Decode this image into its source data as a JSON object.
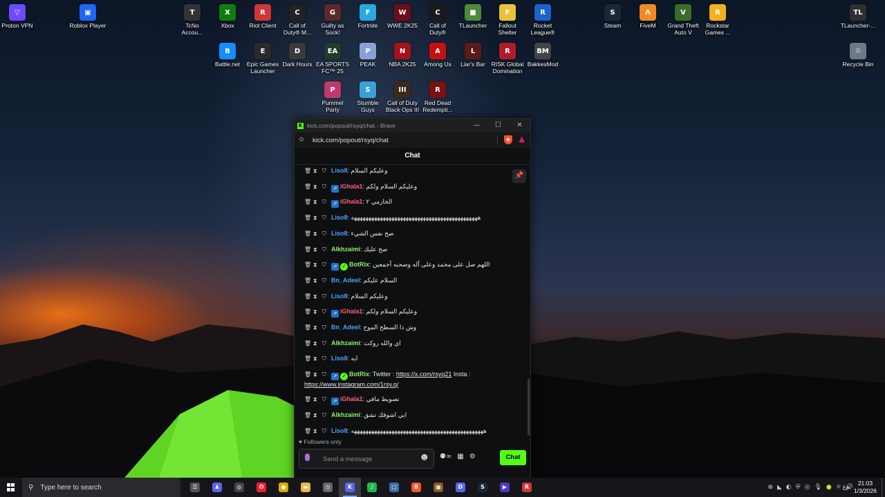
{
  "desktop": {
    "icons": [
      {
        "label": "Proton VPN",
        "glyph": "▽",
        "color": "#6d4aff"
      },
      {
        "label": "Roblox Player",
        "glyph": "▣",
        "color": "#1e66f5"
      },
      {
        "label": "TcNo\nAccou...",
        "glyph": "T",
        "color": "#333333"
      },
      {
        "label": "Xbox",
        "glyph": "X",
        "color": "#107c10"
      },
      {
        "label": "Riot Client",
        "glyph": "R",
        "color": "#d13639"
      },
      {
        "label": "Call of\nDuty® M...",
        "glyph": "C",
        "color": "#222222"
      },
      {
        "label": "Guilty as\nSock!",
        "glyph": "G",
        "color": "#5a2a2a"
      },
      {
        "label": "Fortnite",
        "glyph": "F",
        "color": "#2aa8e0"
      },
      {
        "label": "WWE 2K25",
        "glyph": "W",
        "color": "#6b0f1a"
      },
      {
        "label": "Call of\nDuty®",
        "glyph": "C",
        "color": "#1a1a1a"
      },
      {
        "label": "TLauncher",
        "glyph": "■",
        "color": "#4c8a3c"
      },
      {
        "label": "Fallout\nShelter",
        "glyph": "F",
        "color": "#e8c23a"
      },
      {
        "label": "Rocket\nLeague®",
        "glyph": "R",
        "color": "#1b62c9"
      },
      {
        "label": "Steam",
        "glyph": "S",
        "color": "#1b2838"
      },
      {
        "label": "FiveM",
        "glyph": "Λ",
        "color": "#f28a22"
      },
      {
        "label": "Grand Theft\nAuto V",
        "glyph": "V",
        "color": "#3d6b2a"
      },
      {
        "label": "Rockstar\nGames ...",
        "glyph": "R",
        "color": "#f2b01e"
      },
      {
        "label": "TLauncher-...",
        "glyph": "TL",
        "color": "#2f2f2f"
      },
      {
        "label": "Battle.net",
        "glyph": "B",
        "color": "#148eff"
      },
      {
        "label": "Epic Games\nLauncher",
        "glyph": "E",
        "color": "#2a2a2a"
      },
      {
        "label": "Dark Hours",
        "glyph": "D",
        "color": "#3a3a3a"
      },
      {
        "label": "EA SPORTS\nFC™ 25",
        "glyph": "EA",
        "color": "#233b2a"
      },
      {
        "label": "PEAK",
        "glyph": "P",
        "color": "#8aa0d8"
      },
      {
        "label": "NBA 2K25",
        "glyph": "N",
        "color": "#a3121d"
      },
      {
        "label": "Among Us",
        "glyph": "A",
        "color": "#c51111"
      },
      {
        "label": "Liar's Bar",
        "glyph": "L",
        "color": "#5c1a1a"
      },
      {
        "label": "RISK Global\nDomination",
        "glyph": "R",
        "color": "#b01c2a"
      },
      {
        "label": "BakkesMod",
        "glyph": "BM",
        "color": "#444444"
      },
      {
        "label": "Recycle Bin",
        "glyph": "♲",
        "color": "#6c7a86"
      },
      {
        "label": "Pummel\nParty",
        "glyph": "P",
        "color": "#c0396b"
      },
      {
        "label": "Stumble\nGuys",
        "glyph": "S",
        "color": "#3aa0d8"
      },
      {
        "label": "Call of Duty\nBlack Ops III",
        "glyph": "III",
        "color": "#3b2a1a"
      },
      {
        "label": "Red Dead\nRedempti...",
        "glyph": "R",
        "color": "#7a1010"
      }
    ]
  },
  "browser": {
    "title": "kick.com/popout/rsyq/chat - Brave",
    "url": "kick.com/popout/rsyq/chat",
    "window_controls": {
      "minimize": "—",
      "maximize": "☐",
      "close": "✕"
    }
  },
  "chat": {
    "header": "Chat",
    "messages": [
      {
        "user": "Liso8",
        "color": "#4aa3ff",
        "sub": false,
        "verified": false,
        "text": "وعليكم السلام"
      },
      {
        "user": "iGhala1",
        "color": "#ff5f7a",
        "sub": true,
        "verified": false,
        "text": "وعليكم السلام ولكم"
      },
      {
        "user": "iGhala1",
        "color": "#ff5f7a",
        "sub": true,
        "verified": false,
        "text": "الخازمي ٢"
      },
      {
        "user": "Liso8",
        "color": "#4aa3ff",
        "sub": false,
        "verified": false,
        "text": "ههههههههههههههههههههههههههههههههههههههههههههه"
      },
      {
        "user": "Liso8",
        "color": "#4aa3ff",
        "sub": false,
        "verified": false,
        "text": "صح نفس الشيء"
      },
      {
        "user": "Alkhzaimi",
        "color": "#8ef06a",
        "sub": false,
        "verified": false,
        "text": "صح عليك"
      },
      {
        "user": "BotRix",
        "color": "#8ef06a",
        "sub": true,
        "verified": true,
        "text": "اللهم صل على محمد وعلى آله وصحبه أجمعين"
      },
      {
        "user": "Bn_Adeel",
        "color": "#4aa3ff",
        "sub": false,
        "verified": false,
        "text": "السلام عليكم"
      },
      {
        "user": "Liso8",
        "color": "#4aa3ff",
        "sub": false,
        "verified": false,
        "text": "وعليكم السلام"
      },
      {
        "user": "iGhala1",
        "color": "#ff5f7a",
        "sub": true,
        "verified": false,
        "text": "وعليكم السلام ولكم"
      },
      {
        "user": "Bn_Adeel",
        "color": "#4aa3ff",
        "sub": false,
        "verified": false,
        "text": "وش ذا السطح الموح"
      },
      {
        "user": "Alkhzaimi",
        "color": "#8ef06a",
        "sub": false,
        "verified": false,
        "text": "اي والله روكت"
      },
      {
        "user": "Liso8",
        "color": "#4aa3ff",
        "sub": false,
        "verified": false,
        "text": "ايه"
      },
      {
        "user": "BotRix",
        "color": "#8ef06a",
        "sub": true,
        "verified": true,
        "text": "Twitter : ",
        "link1": "https://x.com/rsyq21",
        "mid": " Insta : ",
        "link2": "https://www.instagram.com/1rsy.q/"
      },
      {
        "user": "iGhala1",
        "color": "#ff5f7a",
        "sub": true,
        "verified": false,
        "text": "تصويط مافي"
      },
      {
        "user": "Alkhzaimi",
        "color": "#8ef06a",
        "sub": false,
        "verified": false,
        "text": "ابي اشوفك تشق"
      },
      {
        "user": "Liso8",
        "color": "#4aa3ff",
        "sub": false,
        "verified": false,
        "text": "ههههههههههههههههههههههههههههههههههههههههههههههه"
      }
    ],
    "followers_only": "Followers only",
    "input_placeholder": "Send a message",
    "send_button": "Chat",
    "accent": "#53fc18"
  },
  "taskbar": {
    "search_placeholder": "Type here to search",
    "apps": [
      {
        "name": "task-view",
        "glyph": "☰",
        "color": "#555555"
      },
      {
        "name": "game-controller",
        "glyph": "♟",
        "color": "#5865f2"
      },
      {
        "name": "steam-circle",
        "glyph": "◎",
        "color": "#444444"
      },
      {
        "name": "opera",
        "glyph": "O",
        "color": "#ff1b2d"
      },
      {
        "name": "chrome",
        "glyph": "●",
        "color": "#e0a800"
      },
      {
        "name": "file-explorer",
        "glyph": "▬",
        "color": "#e8b84a"
      },
      {
        "name": "clock-app",
        "glyph": "◷",
        "color": "#666666"
      },
      {
        "name": "kick-app",
        "glyph": "K",
        "color": "#5865f2"
      },
      {
        "name": "spotify",
        "glyph": "♪",
        "color": "#1db954"
      },
      {
        "name": "window-app",
        "glyph": "□",
        "color": "#3a6ea5"
      },
      {
        "name": "brave",
        "glyph": "B",
        "color": "#fb542b"
      },
      {
        "name": "paint-app",
        "glyph": "▦",
        "color": "#8a5a2a"
      },
      {
        "name": "discord",
        "glyph": "D",
        "color": "#5865f2"
      },
      {
        "name": "steam",
        "glyph": "S",
        "color": "#1b2838"
      },
      {
        "name": "play-app",
        "glyph": "▶",
        "color": "#4a3ac8"
      },
      {
        "name": "red-app",
        "glyph": "R",
        "color": "#d13639"
      }
    ],
    "language": "ع",
    "time": "21:03",
    "date": "1/3/2026"
  }
}
